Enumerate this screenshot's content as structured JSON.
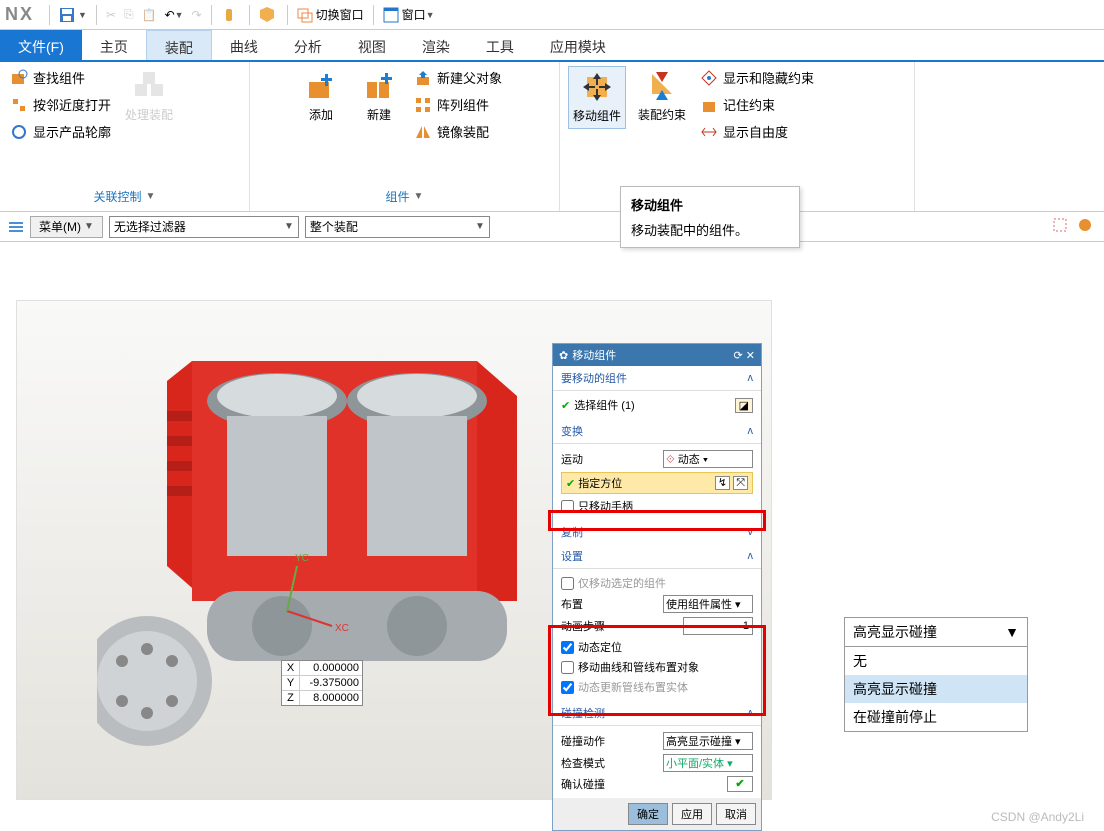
{
  "titlebar": {
    "app": "NX",
    "switch_window": "切换窗口",
    "window_menu": "窗口"
  },
  "menutabs": {
    "file": "文件(F)",
    "home": "主页",
    "assembly": "装配",
    "curve": "曲线",
    "analyze": "分析",
    "view": "视图",
    "render": "渲染",
    "tools": "工具",
    "apps": "应用模块"
  },
  "ribbon": {
    "group1": {
      "title": "关联控制",
      "items": [
        "查找组件",
        "按邻近度打开",
        "显示产品轮廓"
      ],
      "process": "处理装配"
    },
    "group2": {
      "title": "组件",
      "add": "添加",
      "new": "新建",
      "items": [
        "新建父对象",
        "阵列组件",
        "镜像装配"
      ]
    },
    "group3": {
      "move": "移动组件",
      "constraint": "装配约束",
      "items": [
        "显示和隐藏约束",
        "记住约束",
        "显示自由度"
      ]
    }
  },
  "filterbar": {
    "menu": "菜单(M)",
    "no_filter": "无选择过滤器",
    "whole": "整个装配"
  },
  "tooltip": {
    "title": "移动组件",
    "desc": "移动装配中的组件。"
  },
  "coords": {
    "x": "0.000000",
    "y": "-9.375000",
    "z": "8.000000",
    "xl": "X",
    "yl": "Y",
    "zl": "Z",
    "xc": "XC",
    "yc": "YC"
  },
  "dialog": {
    "title": "移动组件",
    "sec_to_move": "要移动的组件",
    "select_comp": "选择组件 (1)",
    "sec_transform": "变换",
    "motion": "运动",
    "motion_val": "动态",
    "specify_orient": "指定方位",
    "only_handle": "只移动手柄",
    "sec_copy": "复制",
    "sec_settings": "设置",
    "only_sel": "仅移动选定的组件",
    "layout": "布置",
    "layout_val": "使用组件属性",
    "anim_step": "动画步骤",
    "anim_step_val": "1",
    "dyn_pos": "动态定位",
    "move_curves": "移动曲线和管线布置对象",
    "dyn_update": "动态更新管线布置实体",
    "sec_collision": "碰撞检测",
    "coll_action": "碰撞动作",
    "coll_action_val": "高亮显示碰撞",
    "check_mode": "检查模式",
    "check_mode_val": "小平面/实体",
    "confirm_coll": "确认碰撞",
    "ok": "确定",
    "apply": "应用",
    "cancel": "取消"
  },
  "dropdown": {
    "current": "高亮显示碰撞",
    "opts": [
      "无",
      "高亮显示碰撞",
      "在碰撞前停止"
    ]
  },
  "watermark": "CSDN @Andy2Li"
}
